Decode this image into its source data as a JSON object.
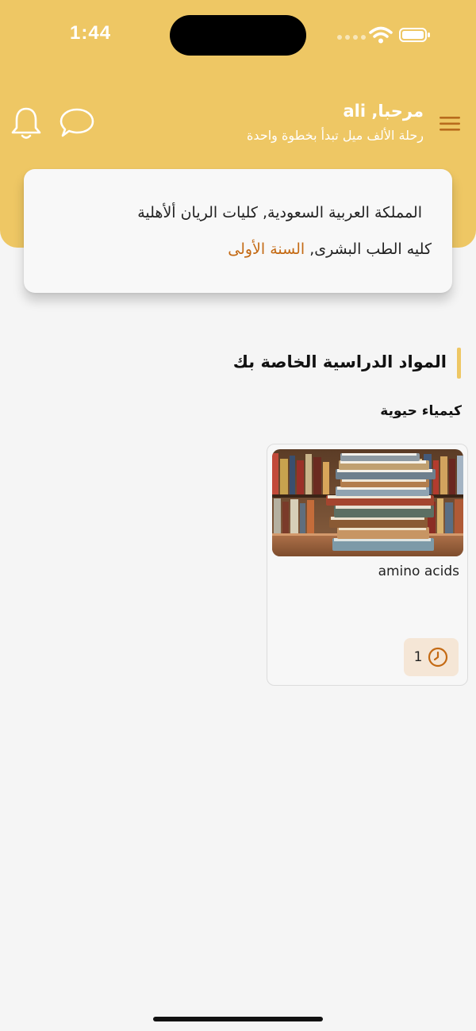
{
  "status_bar": {
    "time": "1:44"
  },
  "header": {
    "greeting": "مرحبا, ali",
    "subtitle": "رحلة الألف ميل تبدأ بخطوة واحدة"
  },
  "profile_card": {
    "university_line": "المملكة العربية السعودية, كليات الريان ألأهلية",
    "college": "كليه الطب البشرى,",
    "year": "السنة الأولى"
  },
  "section": {
    "title": "المواد الدراسية الخاصة بك",
    "subject": "كيمياء حيوية"
  },
  "courses": [
    {
      "title": "amino acids",
      "count": "1"
    }
  ],
  "colors": {
    "accent": "#eec764",
    "highlight": "#c46a14",
    "pill": "#f5e6d6"
  }
}
